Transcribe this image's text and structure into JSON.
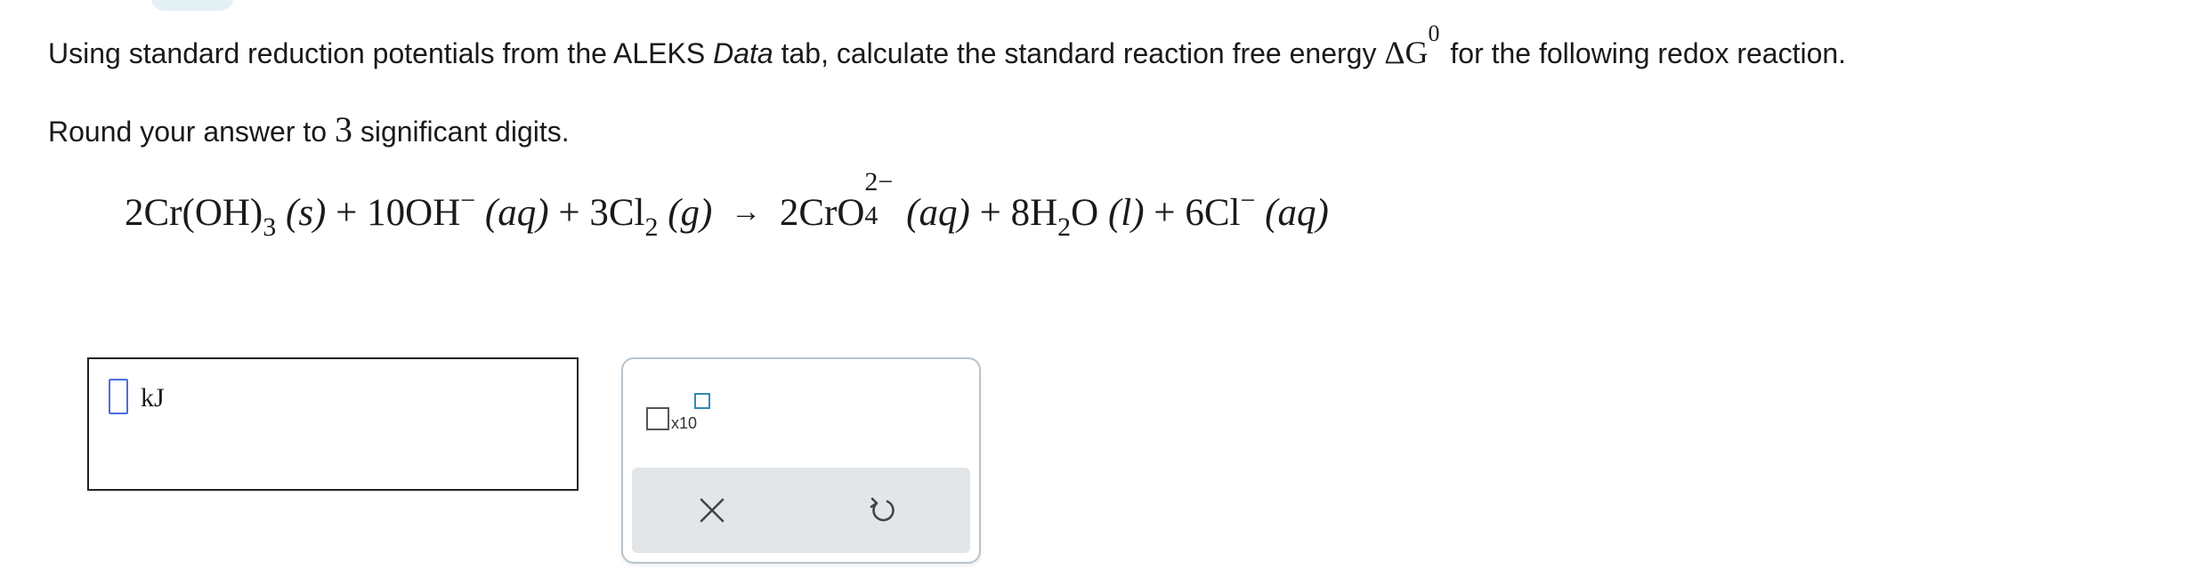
{
  "question": {
    "text_before_data": "Using standard reduction potentials from the ALEKS ",
    "data_word": "Data",
    "text_after_data": " tab, calculate the standard reaction free energy ",
    "delta_g_symbol": "ΔG",
    "delta_g_superscript": "0",
    "text_end": " for the following redox reaction.",
    "round_before": "Round your answer to ",
    "round_number": "3",
    "round_after": " significant digits."
  },
  "equation": {
    "r1_coef": "2",
    "r1_formula": "Cr(OH)",
    "r1_sub": "3",
    "r1_phase": "(s)",
    "plus1": "+",
    "r2_coef": "10",
    "r2_formula": "OH",
    "r2_charge": "−",
    "r2_phase": "(aq)",
    "plus2": "+",
    "r3_coef": "3",
    "r3_formula": "Cl",
    "r3_sub": "2",
    "r3_phase": "(g)",
    "arrow": "→",
    "p1_coef": "2",
    "p1_formula": "CrO",
    "p1_charge": "2−",
    "p1_sub": "4",
    "p1_phase": "(aq)",
    "plus3": "+",
    "p2_coef": "8",
    "p2_formula_a": "H",
    "p2_sub": "2",
    "p2_formula_b": "O",
    "p2_phase": "(l)",
    "plus4": "+",
    "p3_coef": "6",
    "p3_formula": "Cl",
    "p3_charge": "−",
    "p3_phase": "(aq)"
  },
  "answer": {
    "value": "",
    "unit": "kJ"
  },
  "tools": {
    "sci_notation_label": "x10",
    "clear_icon": "close-icon",
    "undo_icon": "undo-icon"
  },
  "colors": {
    "slot_border": "#4a6ee0",
    "exponent_box": "#2e8db0",
    "tab_highlight": "#e4f1f4",
    "action_bar": "#e3e6e9"
  }
}
